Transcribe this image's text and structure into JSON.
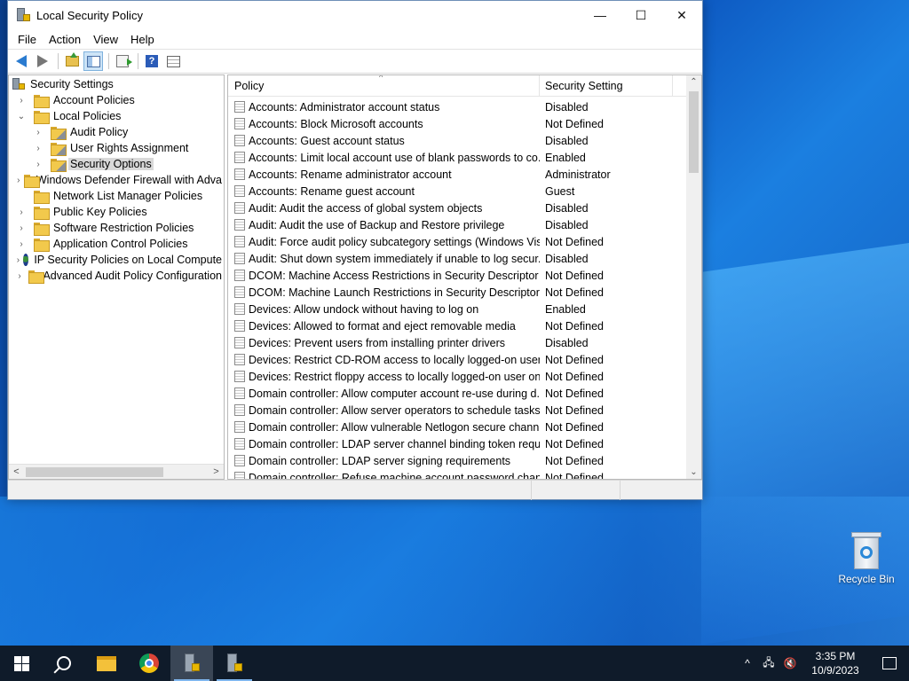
{
  "window": {
    "title": "Local Security Policy",
    "minimize": "—",
    "maximize": "☐",
    "close": "✕"
  },
  "menu": [
    "File",
    "Action",
    "View",
    "Help"
  ],
  "toolbar": {
    "back": "back-arrow-icon",
    "forward": "forward-arrow-icon",
    "up": "folder-up-icon",
    "show_hide_tree": "console-tree-icon",
    "export": "export-list-icon",
    "help": "?",
    "properties": "properties-icon"
  },
  "tree": {
    "root": "Security Settings",
    "items": [
      {
        "label": "Account Policies",
        "level": 1,
        "chevron": "›"
      },
      {
        "label": "Local Policies",
        "level": 1,
        "chevron": "⌄"
      },
      {
        "label": "Audit Policy",
        "level": 2,
        "chevron": "›"
      },
      {
        "label": "User Rights Assignment",
        "level": 2,
        "chevron": "›"
      },
      {
        "label": "Security Options",
        "level": 2,
        "chevron": "›",
        "selected": true
      },
      {
        "label": "Windows Defender Firewall with Adva",
        "level": 1,
        "chevron": "›"
      },
      {
        "label": "Network List Manager Policies",
        "level": 1,
        "chevron": ""
      },
      {
        "label": "Public Key Policies",
        "level": 1,
        "chevron": "›"
      },
      {
        "label": "Software Restriction Policies",
        "level": 1,
        "chevron": "›"
      },
      {
        "label": "Application Control Policies",
        "level": 1,
        "chevron": "›"
      },
      {
        "label": "IP Security Policies on Local Compute",
        "level": 1,
        "chevron": "›"
      },
      {
        "label": "Advanced Audit Policy Configuration",
        "level": 1,
        "chevron": "›"
      }
    ]
  },
  "list": {
    "columns": {
      "policy": "Policy",
      "setting": "Security Setting"
    },
    "rows": [
      {
        "policy": "Accounts: Administrator account status",
        "setting": "Disabled"
      },
      {
        "policy": "Accounts: Block Microsoft accounts",
        "setting": "Not Defined"
      },
      {
        "policy": "Accounts: Guest account status",
        "setting": "Disabled"
      },
      {
        "policy": "Accounts: Limit local account use of blank passwords to co...",
        "setting": "Enabled"
      },
      {
        "policy": "Accounts: Rename administrator account",
        "setting": "Administrator"
      },
      {
        "policy": "Accounts: Rename guest account",
        "setting": "Guest"
      },
      {
        "policy": "Audit: Audit the access of global system objects",
        "setting": "Disabled"
      },
      {
        "policy": "Audit: Audit the use of Backup and Restore privilege",
        "setting": "Disabled"
      },
      {
        "policy": "Audit: Force audit policy subcategory settings (Windows Vis...",
        "setting": "Not Defined"
      },
      {
        "policy": "Audit: Shut down system immediately if unable to log secur...",
        "setting": "Disabled"
      },
      {
        "policy": "DCOM: Machine Access Restrictions in Security Descriptor D...",
        "setting": "Not Defined"
      },
      {
        "policy": "DCOM: Machine Launch Restrictions in Security Descriptor ...",
        "setting": "Not Defined"
      },
      {
        "policy": "Devices: Allow undock without having to log on",
        "setting": "Enabled"
      },
      {
        "policy": "Devices: Allowed to format and eject removable media",
        "setting": "Not Defined"
      },
      {
        "policy": "Devices: Prevent users from installing printer drivers",
        "setting": "Disabled"
      },
      {
        "policy": "Devices: Restrict CD-ROM access to locally logged-on user ...",
        "setting": "Not Defined"
      },
      {
        "policy": "Devices: Restrict floppy access to locally logged-on user only",
        "setting": "Not Defined"
      },
      {
        "policy": "Domain controller: Allow computer account re-use during d...",
        "setting": "Not Defined"
      },
      {
        "policy": "Domain controller: Allow server operators to schedule tasks",
        "setting": "Not Defined"
      },
      {
        "policy": "Domain controller: Allow vulnerable Netlogon secure chann...",
        "setting": "Not Defined"
      },
      {
        "policy": "Domain controller: LDAP server channel binding token requi...",
        "setting": "Not Defined"
      },
      {
        "policy": "Domain controller: LDAP server signing requirements",
        "setting": "Not Defined"
      },
      {
        "policy": "Domain controller: Refuse machine account password chan...",
        "setting": "Not Defined"
      }
    ]
  },
  "desktop": {
    "recycle_bin": "Recycle Bin"
  },
  "taskbar": {
    "time": "3:35 PM",
    "date": "10/9/2023",
    "tray_chevron": "^"
  }
}
